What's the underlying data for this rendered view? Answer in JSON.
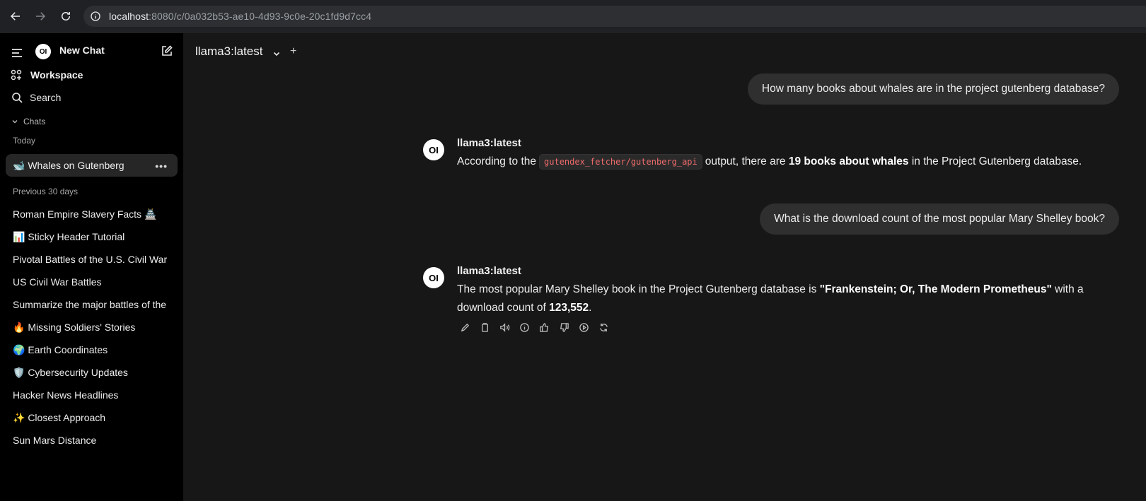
{
  "browser": {
    "url_host": "localhost",
    "url_path": ":8080/c/0a032b53-ae10-4d93-9c0e-20c1fd9d7cc4"
  },
  "sidebar": {
    "new_chat": "New Chat",
    "workspace": "Workspace",
    "search": "Search",
    "chats_header": "Chats",
    "today_header": "Today",
    "active_chat": "🐋 Whales on Gutenberg",
    "more": "•••",
    "previous_header": "Previous 30 days",
    "items": [
      "Roman Empire Slavery Facts 🏯",
      "📊 Sticky Header Tutorial",
      "Pivotal Battles of the U.S. Civil War",
      "US Civil War Battles",
      "Summarize the major battles of the",
      "🔥 Missing Soldiers' Stories",
      "🌍 Earth Coordinates",
      "🛡️ Cybersecurity Updates",
      "Hacker News Headlines",
      "✨ Closest Approach",
      "Sun Mars Distance"
    ]
  },
  "header": {
    "model": "llama3:latest",
    "plus": "+"
  },
  "conversation": {
    "user1": "How many books about whales are in the project gutenberg database?",
    "assistant1": {
      "name": "llama3:latest",
      "avatar": "OI",
      "pre": "According to the",
      "code": "gutendex_fetcher/gutenberg_api",
      "mid": "output, there are",
      "bold": "19 books about whales",
      "post": "in the Project Gutenberg database."
    },
    "user2": "What is the download count of the most popular Mary Shelley book?",
    "assistant2": {
      "name": "llama3:latest",
      "avatar": "OI",
      "pre": "The most popular Mary Shelley book in the Project Gutenberg database is",
      "bold1": "\"Frankenstein; Or, The Modern Prometheus\"",
      "mid": "with a download count of",
      "bold2": "123,552",
      "post": "."
    }
  },
  "logo": "OI"
}
